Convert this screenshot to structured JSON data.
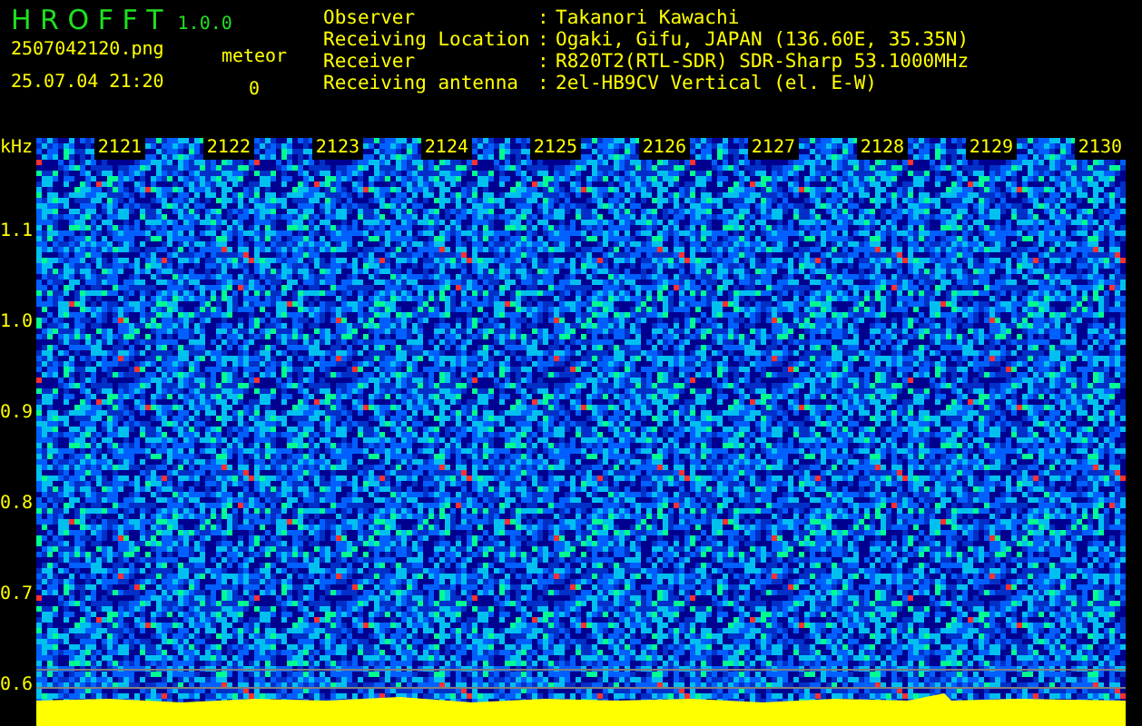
{
  "app": {
    "name": "H R O F F T",
    "version": "1.0.0"
  },
  "file": "2507042120.png",
  "datetime": "25.07.04 21:20",
  "meteor": {
    "label": "meteor",
    "count": "0"
  },
  "info": [
    {
      "label": "Observer",
      "sep": ":",
      "value": "Takanori Kawachi"
    },
    {
      "label": "Receiving Location",
      "sep": ":",
      "value": "Ogaki, Gifu, JAPAN (136.60E, 35.35N)"
    },
    {
      "label": "Receiver",
      "sep": ":",
      "value": "R820T2(RTL-SDR) SDR-Sharp 53.1000MHz"
    },
    {
      "label": "Receiving antenna",
      "sep": ":",
      "value": "2el-HB9CV Vertical (el. E-W)"
    }
  ],
  "axis": {
    "unit": "kHz",
    "y_ticks": [
      "1.1",
      "1.0",
      "0.9",
      "0.8",
      "0.7",
      "0.6"
    ],
    "x_ticks": [
      "2121",
      "2122",
      "2123",
      "2124",
      "2125",
      "2126",
      "2127",
      "2128",
      "2129",
      "2130"
    ]
  }
}
